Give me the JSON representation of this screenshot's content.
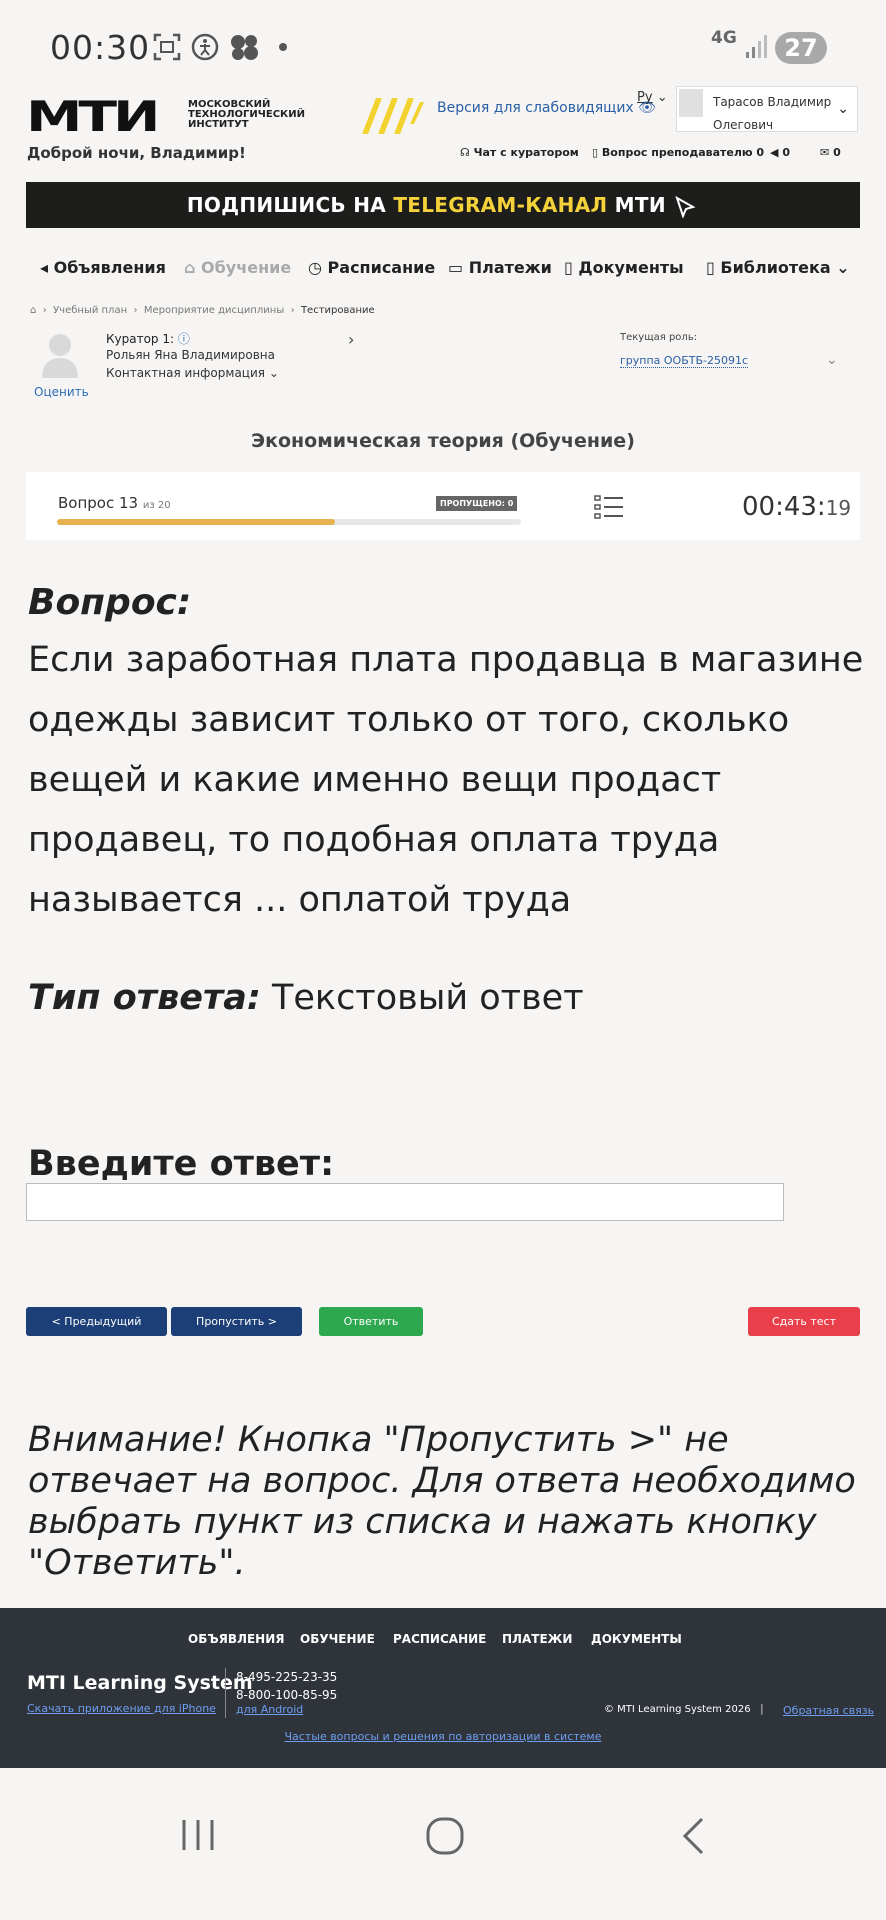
{
  "status_bar": {
    "time": "00:30",
    "network": "4G",
    "battery": "27"
  },
  "header": {
    "logo_text": "МТИ",
    "logo_subtitle": [
      "МОСКОВСКИЙ",
      "ТЕХНОЛОГИЧЕСКИЙ",
      "ИНСТИТУТ"
    ],
    "low_vision_link": "Версия для слабовидящих",
    "lang": "Ру",
    "user_name_line1": "Тарасов Владимир",
    "user_name_line2": "Олегович"
  },
  "subheader": {
    "greeting": "Доброй ночи, Владимир!",
    "chat_curator": "Чат с куратором",
    "ask_teacher": "Вопрос преподавателю 0",
    "notifications_count": "0",
    "messages_count": "0"
  },
  "banner": {
    "prefix": "ПОДПИШИСЬ НА ",
    "highlight": "TELEGRAM-КАНАЛ",
    "suffix": " МТИ"
  },
  "nav": {
    "items": [
      "Объявления",
      "Обучение",
      "Расписание",
      "Платежи",
      "Документы",
      "Библиотека"
    ]
  },
  "breadcrumbs": [
    "Учебный план",
    "Мероприятие дисциплины",
    "Тестирование"
  ],
  "curator": {
    "label": "Куратор 1:",
    "name": "Рольян Яна Владимировна",
    "contact": "Контактная информация",
    "rate": "Оценить",
    "role_label": "Текущая роль:",
    "role_value": "группа ООБТБ-25091с"
  },
  "course_title": "Экономическая теория (Обучение)",
  "question_card": {
    "label": "Вопрос 13",
    "of": "из 20",
    "skipped": "ПРОПУЩЕНО: 0",
    "progress": 0.6,
    "timer_main": "00:43:",
    "timer_sec": "19"
  },
  "question": {
    "heading": "Вопрос:",
    "text": "Если заработная плата продавца в магазине одежды зависит только от того, сколько вещей и какие именно вещи продаст продавец, то подобная оплата труда называется ... оплатой труда",
    "answer_type_label": "Тип ответа:",
    "answer_type_value": " Текстовый ответ",
    "enter_label": "Введите ответ:",
    "answer_value": ""
  },
  "buttons": {
    "prev": "< Предыдущий",
    "skip": "Пропустить >",
    "answer": "Ответить",
    "submit": "Сдать тест"
  },
  "warning": "Внимание! Кнопка \"Пропустить >\" не отвечает на вопрос. Для ответа необходимо выбрать пункт из списка и нажать кнопку \"Ответить\".",
  "footer": {
    "nav": [
      "ОБЪЯВЛЕНИЯ",
      "ОБУЧЕНИЕ",
      "РАСПИСАНИЕ",
      "ПЛАТЕЖИ",
      "ДОКУМЕНТЫ"
    ],
    "brand": "MTI Learning System",
    "iphone": "Скачать приложение для iPhone",
    "phone1": "8-495-225-23-35",
    "phone2": "8-800-100-85-95",
    "android": "для Android",
    "copyright": "© MTI Learning System 2026",
    "separator": "|",
    "feedback": "Обратная связь",
    "faq": "Частые вопросы и решения по авторизации в системе"
  },
  "colors": {
    "primary_blue": "#1c3f77",
    "answer_green": "#2ea84e",
    "submit_red": "#e83f4a",
    "progress_yellow": "#e6b14e",
    "banner_highlight": "#f5d23a"
  },
  "icons": [
    "photo-icon",
    "accessibility-icon",
    "bubbles-icon",
    "eye-icon",
    "headset-icon",
    "book-icon",
    "megaphone-icon",
    "mail-icon",
    "list-icon",
    "home-icon",
    "recents-icon",
    "home-circle-icon",
    "back-icon"
  ]
}
